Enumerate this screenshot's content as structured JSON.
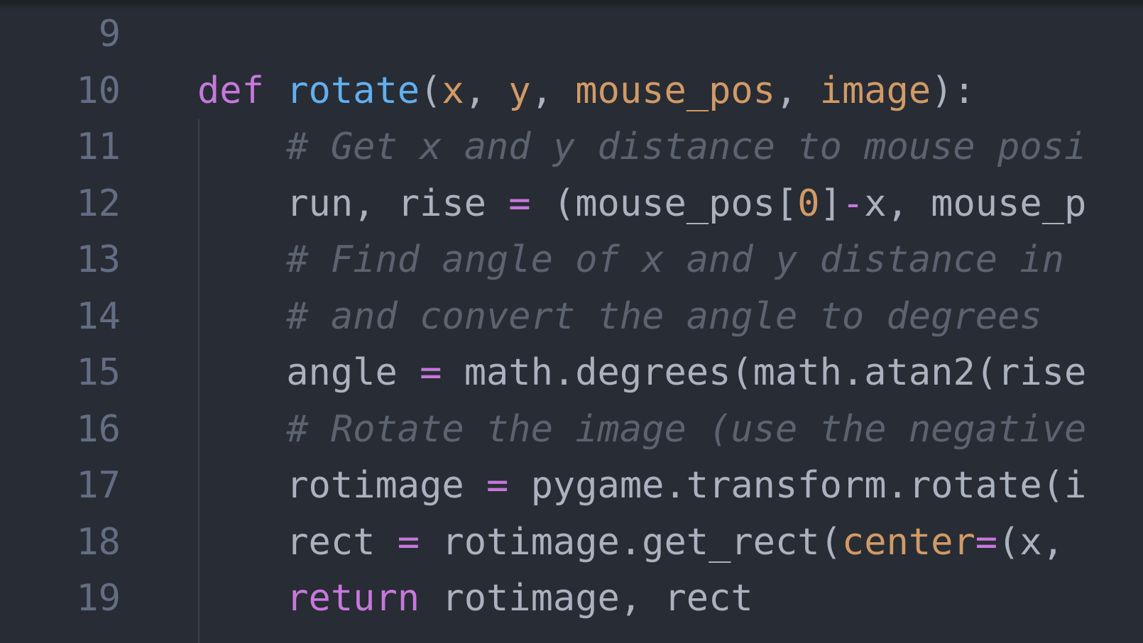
{
  "editor": {
    "theme_colors": {
      "background": "#282c34",
      "keyword": "#c678dd",
      "function": "#61afef",
      "parameter": "#d19a66",
      "comment": "#5c6370",
      "plain": "#abb2bf",
      "line_number": "#636d83"
    },
    "lines": [
      {
        "number": "9",
        "tokens": []
      },
      {
        "number": "10",
        "tokens": [
          {
            "t": "def",
            "c": "kw"
          },
          {
            "t": " ",
            "c": ""
          },
          {
            "t": "rotate",
            "c": "fn"
          },
          {
            "t": "(",
            "c": ""
          },
          {
            "t": "x",
            "c": "param"
          },
          {
            "t": ", ",
            "c": ""
          },
          {
            "t": "y",
            "c": "param"
          },
          {
            "t": ", ",
            "c": ""
          },
          {
            "t": "mouse_pos",
            "c": "param"
          },
          {
            "t": ", ",
            "c": ""
          },
          {
            "t": "image",
            "c": "param"
          },
          {
            "t": "):",
            "c": ""
          }
        ]
      },
      {
        "number": "11",
        "tokens": [
          {
            "t": "    ",
            "c": ""
          },
          {
            "t": "# Get x and y distance to mouse posi",
            "c": "comment"
          }
        ]
      },
      {
        "number": "12",
        "tokens": [
          {
            "t": "    run, rise ",
            "c": ""
          },
          {
            "t": "=",
            "c": "op"
          },
          {
            "t": " (mouse_pos[",
            "c": ""
          },
          {
            "t": "0",
            "c": "num"
          },
          {
            "t": "]",
            "c": ""
          },
          {
            "t": "-",
            "c": "op"
          },
          {
            "t": "x, mouse_p",
            "c": ""
          }
        ]
      },
      {
        "number": "13",
        "tokens": [
          {
            "t": "    ",
            "c": ""
          },
          {
            "t": "# Find angle of x and y distance in",
            "c": "comment"
          }
        ]
      },
      {
        "number": "14",
        "tokens": [
          {
            "t": "    ",
            "c": ""
          },
          {
            "t": "# and convert the angle to degrees",
            "c": "comment"
          }
        ]
      },
      {
        "number": "15",
        "tokens": [
          {
            "t": "    angle ",
            "c": ""
          },
          {
            "t": "=",
            "c": "op"
          },
          {
            "t": " math.degrees(math.atan2(rise",
            "c": ""
          }
        ]
      },
      {
        "number": "16",
        "tokens": [
          {
            "t": "    ",
            "c": ""
          },
          {
            "t": "# Rotate the image (use the negative",
            "c": "comment"
          }
        ]
      },
      {
        "number": "17",
        "tokens": [
          {
            "t": "    rotimage ",
            "c": ""
          },
          {
            "t": "=",
            "c": "op"
          },
          {
            "t": " pygame.transform.rotate(i",
            "c": ""
          }
        ]
      },
      {
        "number": "18",
        "tokens": [
          {
            "t": "    rect ",
            "c": ""
          },
          {
            "t": "=",
            "c": "op"
          },
          {
            "t": " rotimage.get_rect(",
            "c": ""
          },
          {
            "t": "center",
            "c": "param"
          },
          {
            "t": "=",
            "c": "op"
          },
          {
            "t": "(x, ",
            "c": ""
          }
        ]
      },
      {
        "number": "19",
        "tokens": [
          {
            "t": "    ",
            "c": ""
          },
          {
            "t": "return",
            "c": "kw"
          },
          {
            "t": " rotimage, rect",
            "c": ""
          }
        ]
      }
    ]
  }
}
